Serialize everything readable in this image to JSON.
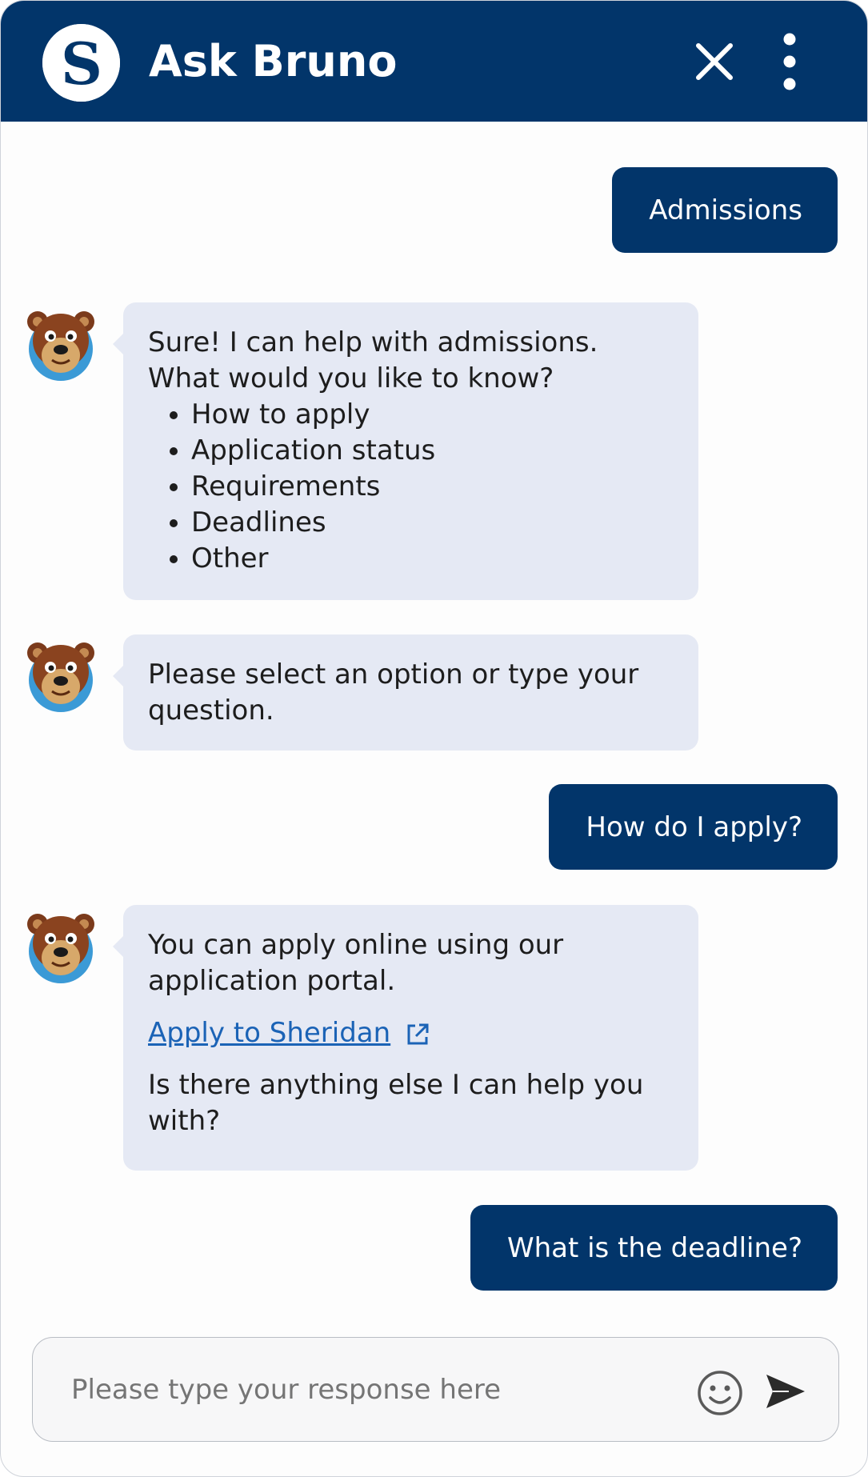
{
  "header": {
    "title": "Ask Bruno",
    "logo_letter": "S",
    "close_icon": "close-icon",
    "menu_icon": "more-vertical-icon",
    "bg_color": "#02356a"
  },
  "messages": [
    {
      "from": "user",
      "text": "Admissions"
    },
    {
      "from": "bot",
      "intro_line1": "Sure! I can help with admissions.",
      "intro_line2": "What would you like to know?",
      "options": [
        "How to apply",
        "Application status",
        "Requirements",
        "Deadlines",
        "Other"
      ]
    },
    {
      "from": "bot",
      "text": "Please select an option or type your question."
    },
    {
      "from": "user",
      "text": "How do I apply?"
    },
    {
      "from": "bot",
      "text": "You can apply online using our application portal.",
      "link_text": "Apply to Sheridan",
      "follow_up": "Is there anything else I can help you with?"
    },
    {
      "from": "user",
      "text": "What is the deadline?"
    }
  ],
  "composer": {
    "placeholder": "Please type your response here",
    "value": "",
    "emoji_icon": "smiley-icon",
    "send_icon": "send-icon"
  },
  "colors": {
    "brand": "#02356a",
    "bot_bubble": "#e5e9f4",
    "link": "#1b63b6"
  }
}
